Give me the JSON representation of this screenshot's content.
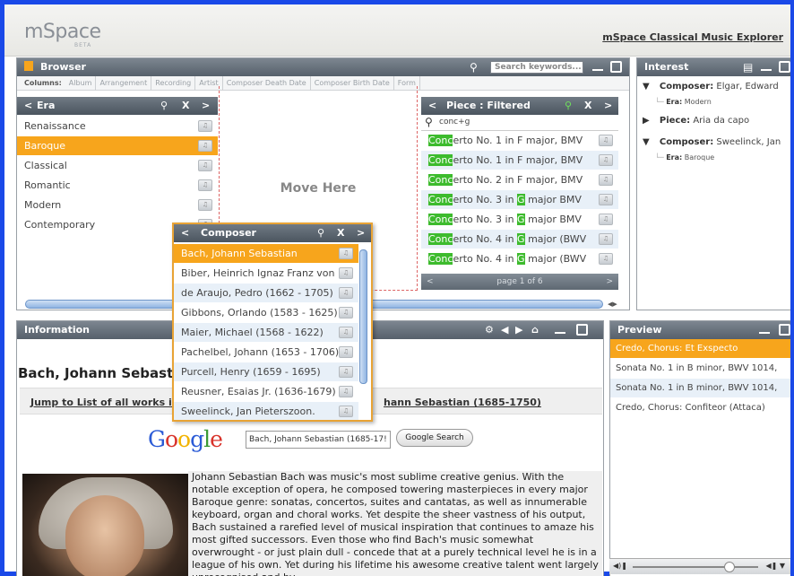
{
  "header": {
    "logo": "mSpace",
    "beta": "BETA",
    "app_title": "mSpace Classical Music Explorer"
  },
  "browser": {
    "title": "Browser",
    "search_placeholder": "Search keywords...",
    "columns_label": "Columns:",
    "columns": [
      "Album",
      "Arrangement",
      "Recording",
      "Artist",
      "Composer Death Date",
      "Composer Birth Date",
      "Form"
    ],
    "move_here": "Move Here",
    "era": {
      "title": "Era",
      "items": [
        "Renaissance",
        "Baroque",
        "Classical",
        "Romantic",
        "Modern",
        "Contemporary"
      ],
      "selected_index": 1
    },
    "piece": {
      "title": "Piece : Filtered",
      "filter_value": "conc+g",
      "items": [
        {
          "hl": "Conc",
          "rest": "erto No. 1 in F major, BMV"
        },
        {
          "hl": "Conc",
          "rest": "erto No. 1 in F major, BMV"
        },
        {
          "hl": "Conc",
          "rest": "erto No. 2 in F major, BMV"
        },
        {
          "pre": "Conc",
          "mid": "erto No. 3 in ",
          "g": "G",
          "post": " major BMV"
        },
        {
          "pre": "Conc",
          "mid": "erto No. 3 in ",
          "g": "G",
          "post": " major BMV"
        },
        {
          "pre": "Conc",
          "mid": "erto No. 4 in ",
          "g": "G",
          "post": " major (BWV"
        },
        {
          "pre": "Conc",
          "mid": "erto No. 4 in ",
          "g": "G",
          "post": " major (BWV"
        }
      ],
      "pager": "page 1 of 6"
    },
    "composer": {
      "title": "Composer",
      "items": [
        "Bach, Johann Sebastian",
        "Biber, Heinrich Ignaz Franz von",
        "de Araujo, Pedro (1662 - 1705)",
        "Gibbons, Orlando (1583 - 1625)",
        "Maier, Michael (1568 - 1622)",
        "Pachelbel, Johann (1653 - 1706)",
        "Purcell, Henry (1659 - 1695)",
        "Reusner, Esaias Jr. (1636-1679)",
        "Sweelinck, Jan Pieterszoon."
      ],
      "selected_index": 0
    }
  },
  "interest": {
    "title": "Interest",
    "items": [
      {
        "label": "Composer:",
        "value": "Elgar, Edward",
        "sub_label": "Era:",
        "sub_value": "Modern",
        "expanded": true
      },
      {
        "label": "Piece:",
        "value": "Aria da capo",
        "expanded": false
      },
      {
        "label": "Composer:",
        "value": "Sweelinck, Jan",
        "sub_label": "Era:",
        "sub_value": "Baroque",
        "expanded": true
      }
    ]
  },
  "information": {
    "title": "Information",
    "heading": "Bach, Johann Sebasti",
    "jump_left": "Jump to List of all works in",
    "jump_right": "hann Sebastian (1685-1750)",
    "google_value": "Bach, Johann Sebastian (1685-17!",
    "google_button": "Google Search",
    "bio": "Johann Sebastian Bach was music's most sublime creative genius. With the notable exception of opera, he composed towering masterpieces in every major Baroque genre: sonatas, concertos, suites and cantatas, as well as innumerable keyboard, organ and choral works. Yet despite the sheer vastness of his output, Bach sustained a rarefied level of musical inspiration that continues to amaze his most gifted successors. Even those who find Bach's music somewhat overwrought - or just plain dull - concede that at a purely technical level he is in a league of his own. Yet during his lifetime his awesome creative talent went largely unrecognised and by"
  },
  "preview": {
    "title": "Preview",
    "items": [
      "Credo, Chorus: Et Exspecto",
      "Sonata No. 1 in B minor, BWV 1014,",
      "Sonata No. 1 in B minor, BWV 1014,",
      "Credo, Chorus: Confiteor (Attaca)"
    ],
    "selected_index": 0
  },
  "colors": {
    "accent": "#f7a51c",
    "highlight": "#3dbb2d",
    "frame": "#1a49e8",
    "titlebar": "#5e6872"
  }
}
